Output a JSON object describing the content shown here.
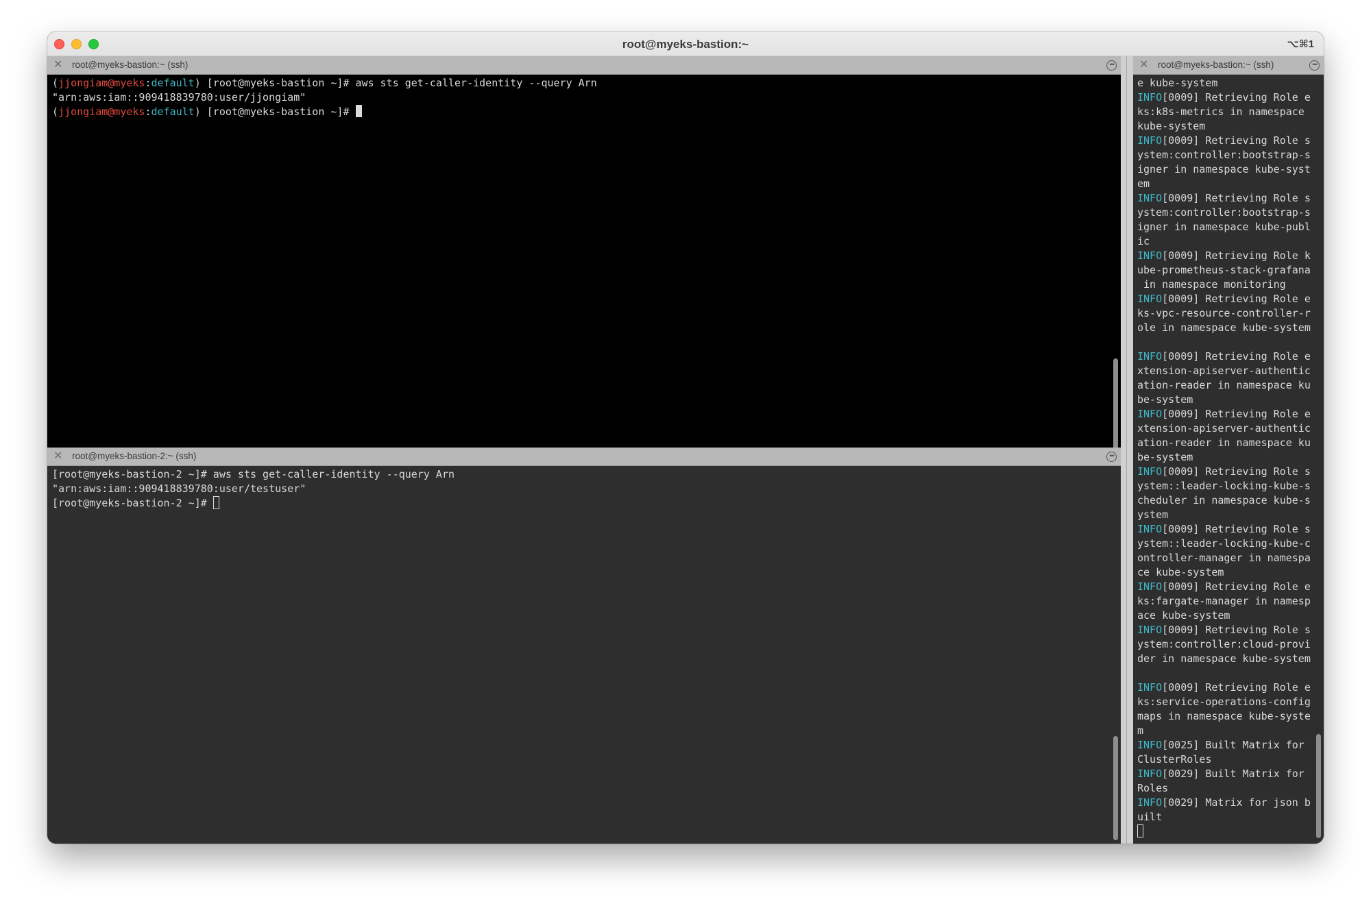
{
  "window": {
    "title": "root@myeks-bastion:~",
    "shortcut": "⌥⌘1"
  },
  "pane_top": {
    "tab_title": "root@myeks-bastion:~ (ssh)",
    "lines": [
      [
        [
          "(",
          ""
        ],
        [
          "jjongiam@myeks",
          "red"
        ],
        [
          ":",
          ""
        ],
        [
          "default",
          "cyan"
        ],
        [
          ") [root@myeks-bastion ~]# aws sts get-caller-identity --query Arn",
          ""
        ]
      ],
      [
        [
          "\"arn:aws:iam::909418839780:user/jjongiam\"",
          ""
        ]
      ],
      [
        [
          "(",
          ""
        ],
        [
          "jjongiam@myeks",
          "red"
        ],
        [
          ":",
          ""
        ],
        [
          "default",
          "cyan"
        ],
        [
          ") [root@myeks-bastion ~]# ",
          ""
        ],
        [
          "",
          "cursor-block"
        ]
      ]
    ]
  },
  "pane_bottom": {
    "tab_title": "root@myeks-bastion-2:~ (ssh)",
    "lines": [
      [
        [
          "[root@myeks-bastion-2 ~]# aws sts get-caller-identity --query Arn",
          ""
        ]
      ],
      [
        [
          "\"arn:aws:iam::909418839780:user/testuser\"",
          ""
        ]
      ],
      [
        [
          "[root@myeks-bastion-2 ~]# ",
          ""
        ],
        [
          "",
          "cursor-hollow"
        ]
      ]
    ]
  },
  "pane_right": {
    "tab_title": "root@myeks-bastion:~ (ssh)",
    "lines": [
      [
        [
          "e kube-system",
          ""
        ]
      ],
      [
        [
          "INFO",
          "cyan"
        ],
        [
          "[0009] Retrieving Role e",
          ""
        ]
      ],
      [
        [
          "ks:k8s-metrics in namespace",
          ""
        ]
      ],
      [
        [
          "kube-system",
          ""
        ]
      ],
      [
        [
          "INFO",
          "cyan"
        ],
        [
          "[0009] Retrieving Role s",
          ""
        ]
      ],
      [
        [
          "ystem:controller:bootstrap-s",
          ""
        ]
      ],
      [
        [
          "igner in namespace kube-syst",
          ""
        ]
      ],
      [
        [
          "em",
          ""
        ]
      ],
      [
        [
          "INFO",
          "cyan"
        ],
        [
          "[0009] Retrieving Role s",
          ""
        ]
      ],
      [
        [
          "ystem:controller:bootstrap-s",
          ""
        ]
      ],
      [
        [
          "igner in namespace kube-publ",
          ""
        ]
      ],
      [
        [
          "ic",
          ""
        ]
      ],
      [
        [
          "INFO",
          "cyan"
        ],
        [
          "[0009] Retrieving Role k",
          ""
        ]
      ],
      [
        [
          "ube-prometheus-stack-grafana",
          ""
        ]
      ],
      [
        [
          " in namespace monitoring",
          ""
        ]
      ],
      [
        [
          "INFO",
          "cyan"
        ],
        [
          "[0009] Retrieving Role e",
          ""
        ]
      ],
      [
        [
          "ks-vpc-resource-controller-r",
          ""
        ]
      ],
      [
        [
          "ole in namespace kube-system",
          ""
        ]
      ],
      [
        [
          "",
          ""
        ]
      ],
      [
        [
          "INFO",
          "cyan"
        ],
        [
          "[0009] Retrieving Role e",
          ""
        ]
      ],
      [
        [
          "xtension-apiserver-authentic",
          ""
        ]
      ],
      [
        [
          "ation-reader in namespace ku",
          ""
        ]
      ],
      [
        [
          "be-system",
          ""
        ]
      ],
      [
        [
          "INFO",
          "cyan"
        ],
        [
          "[0009] Retrieving Role e",
          ""
        ]
      ],
      [
        [
          "xtension-apiserver-authentic",
          ""
        ]
      ],
      [
        [
          "ation-reader in namespace ku",
          ""
        ]
      ],
      [
        [
          "be-system",
          ""
        ]
      ],
      [
        [
          "INFO",
          "cyan"
        ],
        [
          "[0009] Retrieving Role s",
          ""
        ]
      ],
      [
        [
          "ystem::leader-locking-kube-s",
          ""
        ]
      ],
      [
        [
          "cheduler in namespace kube-s",
          ""
        ]
      ],
      [
        [
          "ystem",
          ""
        ]
      ],
      [
        [
          "INFO",
          "cyan"
        ],
        [
          "[0009] Retrieving Role s",
          ""
        ]
      ],
      [
        [
          "ystem::leader-locking-kube-c",
          ""
        ]
      ],
      [
        [
          "ontroller-manager in namespa",
          ""
        ]
      ],
      [
        [
          "ce kube-system",
          ""
        ]
      ],
      [
        [
          "INFO",
          "cyan"
        ],
        [
          "[0009] Retrieving Role e",
          ""
        ]
      ],
      [
        [
          "ks:fargate-manager in namesp",
          ""
        ]
      ],
      [
        [
          "ace kube-system",
          ""
        ]
      ],
      [
        [
          "INFO",
          "cyan"
        ],
        [
          "[0009] Retrieving Role s",
          ""
        ]
      ],
      [
        [
          "ystem:controller:cloud-provi",
          ""
        ]
      ],
      [
        [
          "der in namespace kube-system",
          ""
        ]
      ],
      [
        [
          "",
          ""
        ]
      ],
      [
        [
          "INFO",
          "cyan"
        ],
        [
          "[0009] Retrieving Role e",
          ""
        ]
      ],
      [
        [
          "ks:service-operations-config",
          ""
        ]
      ],
      [
        [
          "maps in namespace kube-syste",
          ""
        ]
      ],
      [
        [
          "m",
          ""
        ]
      ],
      [
        [
          "INFO",
          "cyan"
        ],
        [
          "[0025] Built Matrix for",
          ""
        ]
      ],
      [
        [
          "ClusterRoles",
          ""
        ]
      ],
      [
        [
          "INFO",
          "cyan"
        ],
        [
          "[0029] Built Matrix for",
          ""
        ]
      ],
      [
        [
          "Roles",
          ""
        ]
      ],
      [
        [
          "INFO",
          "cyan"
        ],
        [
          "[0029] Matrix for json b",
          ""
        ]
      ],
      [
        [
          "uilt",
          ""
        ]
      ],
      [
        [
          "",
          "cursor-hollow"
        ]
      ]
    ]
  }
}
